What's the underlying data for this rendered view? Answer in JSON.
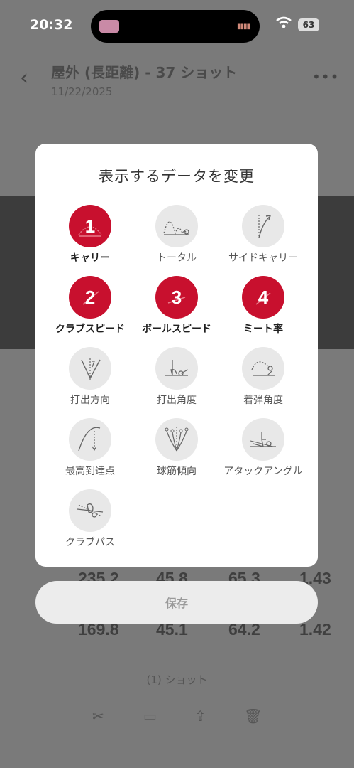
{
  "status_bar": {
    "time": "20:32",
    "battery": "63"
  },
  "background": {
    "title": "屋外 (長距離) - 37 ショット",
    "date": "11/22/2025",
    "rows": [
      {
        "values": [
          "235.2",
          "45.8",
          "65.3",
          "1.43"
        ]
      },
      {
        "values": [
          "169.8",
          "45.1",
          "64.2",
          "1.42"
        ]
      }
    ],
    "footer": "(1) ショット"
  },
  "modal": {
    "title": "表示するデータを変更",
    "options": [
      {
        "label": "キャリー",
        "selected": true,
        "number": "1",
        "icon": "carry-icon"
      },
      {
        "label": "トータル",
        "selected": false,
        "number": "",
        "icon": "total-icon"
      },
      {
        "label": "サイドキャリー",
        "selected": false,
        "number": "",
        "icon": "side-carry-icon"
      },
      {
        "label": "クラブスピード",
        "selected": true,
        "number": "2",
        "icon": "club-speed-icon"
      },
      {
        "label": "ボールスピード",
        "selected": true,
        "number": "3",
        "icon": "ball-speed-icon"
      },
      {
        "label": "ミート率",
        "selected": true,
        "number": "4",
        "icon": "smash-factor-icon"
      },
      {
        "label": "打出方向",
        "selected": false,
        "number": "",
        "icon": "launch-direction-icon"
      },
      {
        "label": "打出角度",
        "selected": false,
        "number": "",
        "icon": "launch-angle-icon"
      },
      {
        "label": "着弾角度",
        "selected": false,
        "number": "",
        "icon": "descent-angle-icon"
      },
      {
        "label": "最高到達点",
        "selected": false,
        "number": "",
        "icon": "apex-icon"
      },
      {
        "label": "球筋傾向",
        "selected": false,
        "number": "",
        "icon": "shot-shape-icon"
      },
      {
        "label": "アタックアングル",
        "selected": false,
        "number": "",
        "icon": "attack-angle-icon"
      },
      {
        "label": "クラブパス",
        "selected": false,
        "number": "",
        "icon": "club-path-icon"
      }
    ],
    "save_label": "保存"
  },
  "colors": {
    "selected": "#c8102e",
    "unselected": "#e8e8e8"
  }
}
